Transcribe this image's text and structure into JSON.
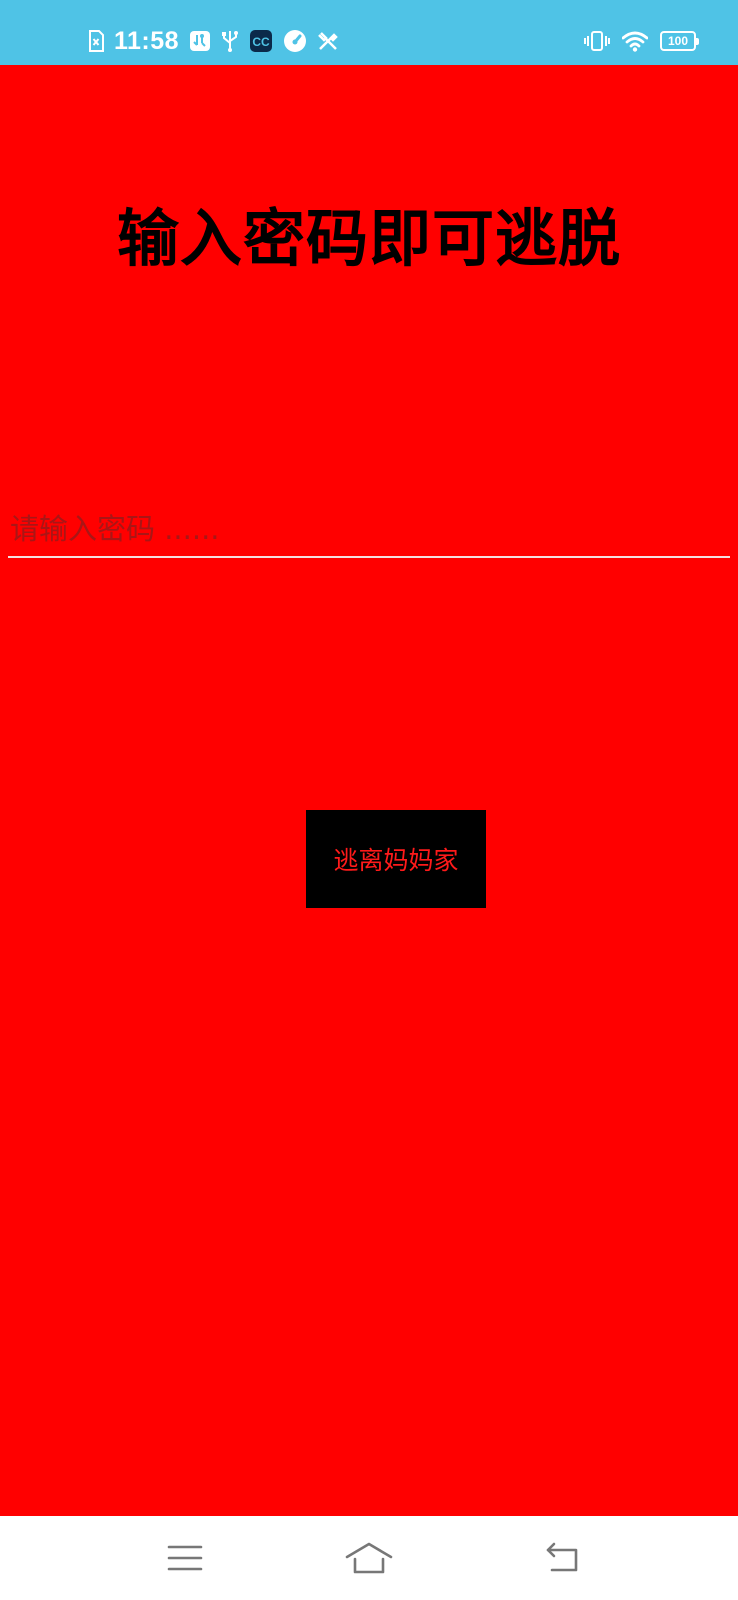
{
  "status_bar": {
    "time": "11:58",
    "battery": "100",
    "left_icons": [
      "sim-card-icon",
      "usb-debug-icon",
      "usb-icon",
      "app-cc-icon",
      "speedometer-icon",
      "tools-icon"
    ],
    "right_icons": [
      "vibrate-icon",
      "wifi-icon",
      "battery-icon"
    ]
  },
  "main": {
    "title": "输入密码即可逃脱",
    "password_placeholder": "请输入密码 ......",
    "password_value": "",
    "escape_button_label": "逃离妈妈家"
  },
  "nav_bar": {
    "icons": [
      "menu-icon",
      "home-icon",
      "back-icon"
    ]
  },
  "colors": {
    "background": "#ff0000",
    "status_bar": "#4fc3e6",
    "button_bg": "#000000",
    "button_text": "#ff1a1a",
    "title_text": "#000000",
    "nav_bar": "#ffffff"
  }
}
